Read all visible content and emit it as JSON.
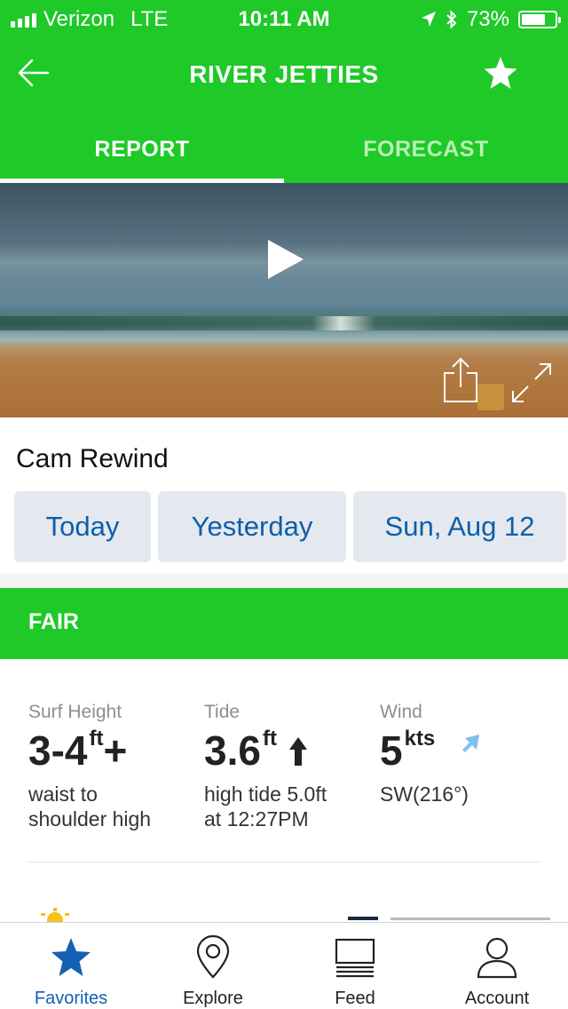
{
  "status_bar": {
    "carrier": "Verizon",
    "network": "LTE",
    "time": "10:11 AM",
    "battery_percent": "73%",
    "battery_level": 0.73
  },
  "header": {
    "title": "RIVER JETTIES",
    "tabs": [
      {
        "label": "REPORT",
        "active": true
      },
      {
        "label": "FORECAST",
        "active": false
      }
    ]
  },
  "cam_rewind": {
    "title": "Cam Rewind",
    "days": [
      "Today",
      "Yesterday",
      "Sun, Aug 12"
    ]
  },
  "condition": {
    "label": "FAIR",
    "color": "#1ec928"
  },
  "stats": {
    "surf": {
      "label": "Surf Height",
      "value": "3-4",
      "unit": "ft",
      "suffix": "+",
      "desc_line1": "waist to",
      "desc_line2": "shoulder high"
    },
    "tide": {
      "label": "Tide",
      "value": "3.6",
      "unit": "ft",
      "desc_line1": "high tide 5.0ft",
      "desc_line2": "at 12:27PM"
    },
    "wind": {
      "label": "Wind",
      "value": "5",
      "unit": "kts",
      "desc_line1": "SW(216°)"
    }
  },
  "tabbar": {
    "items": [
      {
        "label": "Favorites",
        "icon": "star-icon",
        "active": true
      },
      {
        "label": "Explore",
        "icon": "map-pin-icon",
        "active": false
      },
      {
        "label": "Feed",
        "icon": "feed-icon",
        "active": false
      },
      {
        "label": "Account",
        "icon": "person-icon",
        "active": false
      }
    ]
  },
  "colors": {
    "brand_green": "#1ec928",
    "link_blue": "#0f5ea8",
    "active_tab_blue": "#1460b4",
    "wind_arrow": "#7fc1ee"
  }
}
